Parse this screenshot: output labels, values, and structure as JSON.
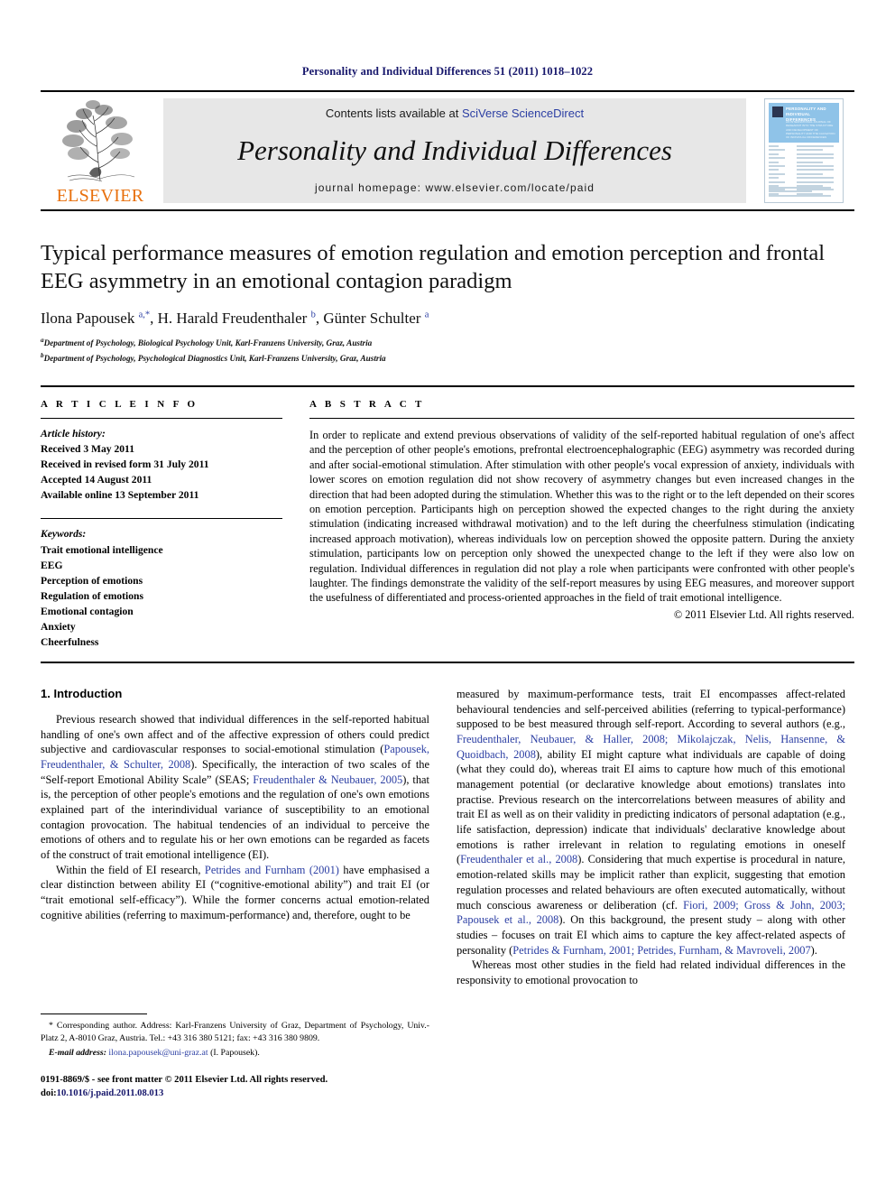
{
  "running_head": "Personality and Individual Differences 51 (2011) 1018–1022",
  "masthead": {
    "publisher": "ELSEVIER",
    "contents_prefix": "Contents lists available at",
    "sciencedirect_link": "SciVerse ScienceDirect",
    "journal_name": "Personality and Individual Differences",
    "homepage": "journal homepage: www.elsevier.com/locate/paid",
    "cover": {
      "title": "PERSONALITY AND INDIVIDUAL DIFFERENCES",
      "subtitle": "AN INTERNATIONAL JOURNAL OF RESEARCH INTO THE STRUCTURE AND DEVELOPMENT OF PERSONALITY AND THE CAUSATION OF INDIVIDUAL DIFFERENCES"
    }
  },
  "article": {
    "title": "Typical performance measures of emotion regulation and emotion perception and frontal EEG asymmetry in an emotional contagion paradigm",
    "authors_html": "Ilona Papousek <sup>a,</sup><sup>*</sup>, H. Harald Freudenthaler <sup>b</sup>, Günter Schulter <sup>a</sup>",
    "affiliation_a": "Department of Psychology, Biological Psychology Unit, Karl-Franzens University, Graz, Austria",
    "affiliation_b": "Department of Psychology, Psychological Diagnostics Unit, Karl-Franzens University, Graz, Austria"
  },
  "article_info": {
    "heading": "A R T I C L E   I N F O",
    "history_label": "Article history:",
    "history": [
      "Received 3 May 2011",
      "Received in revised form 31 July 2011",
      "Accepted 14 August 2011",
      "Available online 13 September 2011"
    ],
    "keywords_label": "Keywords:",
    "keywords": [
      "Trait emotional intelligence",
      "EEG",
      "Perception of emotions",
      "Regulation of emotions",
      "Emotional contagion",
      "Anxiety",
      "Cheerfulness"
    ]
  },
  "abstract": {
    "heading": "A B S T R A C T",
    "text": "In order to replicate and extend previous observations of validity of the self-reported habitual regulation of one's affect and the perception of other people's emotions, prefrontal electroencephalographic (EEG) asymmetry was recorded during and after social-emotional stimulation. After stimulation with other people's vocal expression of anxiety, individuals with lower scores on emotion regulation did not show recovery of asymmetry changes but even increased changes in the direction that had been adopted during the stimulation. Whether this was to the right or to the left depended on their scores on emotion perception. Participants high on perception showed the expected changes to the right during the anxiety stimulation (indicating increased withdrawal motivation) and to the left during the cheerfulness stimulation (indicating increased approach motivation), whereas individuals low on perception showed the opposite pattern. During the anxiety stimulation, participants low on perception only showed the unexpected change to the left if they were also low on regulation. Individual differences in regulation did not play a role when participants were confronted with other people's laughter. The findings demonstrate the validity of the self-report measures by using EEG measures, and moreover support the usefulness of differentiated and process-oriented approaches in the field of trait emotional intelligence.",
    "copyright": "© 2011 Elsevier Ltd. All rights reserved."
  },
  "introduction": {
    "section_title": "1. Introduction",
    "left_paragraph_1": [
      {
        "t": "Previous research showed that individual differences in the self-reported habitual handling of one's own affect and of the affective expression of others could predict subjective and cardiovascular responses to social-emotional stimulation ("
      },
      {
        "t": "Papousek, Freudenthaler, & Schulter, 2008",
        "cite": true
      },
      {
        "t": "). Specifically, the interaction of two scales of the “Self-report Emotional Ability Scale” (SEAS; "
      },
      {
        "t": "Freudenthaler & Neubauer, 2005",
        "cite": true
      },
      {
        "t": "), that is, the perception of other people's emotions and the regulation of one's own emotions explained part of the interindividual variance of susceptibility to an emotional contagion provocation. The habitual tendencies of an individual to perceive the emotions of others and to regulate his or her own emotions can be regarded as facets of the construct of trait emotional intelligence (EI)."
      }
    ],
    "left_paragraph_2": [
      {
        "t": "Within the field of EI research, "
      },
      {
        "t": "Petrides and Furnham (2001)",
        "cite": true
      },
      {
        "t": " have emphasised a clear distinction between ability EI (“cognitive-emotional ability”) and trait EI (or “trait emotional self-efficacy”). While the former concerns actual emotion-related cognitive abilities (referring to maximum-performance) and, therefore, ought to be"
      }
    ],
    "right_paragraph_1": [
      {
        "t": "measured by maximum-performance tests, trait EI encompasses affect-related behavioural tendencies and self-perceived abilities (referring to typical-performance) supposed to be best measured through self-report. According to several authors (e.g., "
      },
      {
        "t": "Freudenthaler, Neubauer, & Haller, 2008; Mikolajczak, Nelis, Hansenne, & Quoidbach, 2008",
        "cite": true
      },
      {
        "t": "), ability EI might capture what individuals are capable of doing (what they could do), whereas trait EI aims to capture how much of this emotional management potential (or declarative knowledge about emotions) translates into practise. Previous research on the intercorrelations between measures of ability and trait EI as well as on their validity in predicting indicators of personal adaptation (e.g., life satisfaction, depression) indicate that individuals' declarative knowledge about emotions is rather irrelevant in relation to regulating emotions in oneself ("
      },
      {
        "t": "Freudenthaler et al., 2008",
        "cite": true
      },
      {
        "t": "). Considering that much expertise is procedural in nature, emotion-related skills may be implicit rather than explicit, suggesting that emotion regulation processes and related behaviours are often executed automatically, without much conscious awareness or deliberation (cf. "
      },
      {
        "t": "Fiori, 2009; Gross & John, 2003; Papousek et al., 2008",
        "cite": true
      },
      {
        "t": "). On this background, the present study – along with other studies – focuses on trait EI which aims to capture the key affect-related aspects of personality ("
      },
      {
        "t": "Petrides & Furnham, 2001; Petrides, Furnham, & Mavroveli, 2007",
        "cite": true
      },
      {
        "t": ")."
      }
    ],
    "right_paragraph_2": [
      {
        "t": "Whereas most other studies in the field had related individual differences in the responsivity to emotional provocation to"
      }
    ]
  },
  "footnote": {
    "marker": "*",
    "text": "Corresponding author. Address: Karl-Franzens University of Graz, Department of Psychology, Univ.-Platz 2, A-8010 Graz, Austria. Tel.: +43 316 380 5121; fax: +43 316 380 9809.",
    "email_label": "E-mail address:",
    "email": "ilona.papousek@uni-graz.at",
    "email_suffix": "(I. Papousek)."
  },
  "footer": {
    "issn_line": "0191-8869/$ - see front matter © 2011 Elsevier Ltd. All rights reserved.",
    "doi_label": "doi:",
    "doi": "10.1016/j.paid.2011.08.013"
  },
  "colors": {
    "link": "#2b3ea3",
    "running_head": "#16166b",
    "elsevier_orange": "#e8700d",
    "cover_blue": "#8fc3e8",
    "banner_gray": "#e7e7e7"
  }
}
